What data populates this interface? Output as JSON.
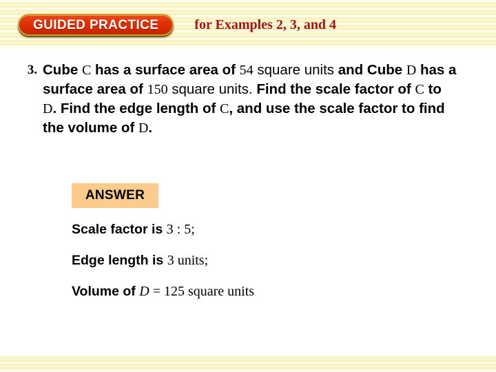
{
  "header": {
    "badge_label": "GUIDED PRACTICE",
    "subtitle": "for Examples 2, 3, and 4",
    "badge_color": "#e13307",
    "badge_border_color": "#c9a227",
    "subtitle_color": "#a41414"
  },
  "problem": {
    "number": "3.",
    "line1_a": "Cube ",
    "line1_c": "C",
    "line1_b": " has a surface area of ",
    "line1_val": "54",
    "line1_units": " square units",
    "line1_and": " and",
    "line2_a": "Cube ",
    "line2_d": "D",
    "line2_b": " has a surface area of ",
    "line2_val": "150",
    "line2_units": " square units.",
    "line3_a": "Find the scale factor of ",
    "line3_c": "C",
    "line3_b": " to ",
    "line3_d": "D",
    "line3_c2": ". Find the edge",
    "line4_a": "length of ",
    "line4_c": "C",
    "line4_b": ", and use the scale factor to find the",
    "line5_a": "volume of ",
    "line5_d": "D",
    "line5_b": "."
  },
  "answer": {
    "tag_label": "ANSWER",
    "tag_bg_color": "#fbcc8b",
    "line1_label": "Scale factor is ",
    "line1_value": "3 : 5;",
    "line2_label": "Edge length is ",
    "line2_value": "3 units;",
    "line3_label": "Volume of ",
    "line3_var": "D",
    "line3_eq": " = ",
    "line3_value": "125 square units"
  }
}
